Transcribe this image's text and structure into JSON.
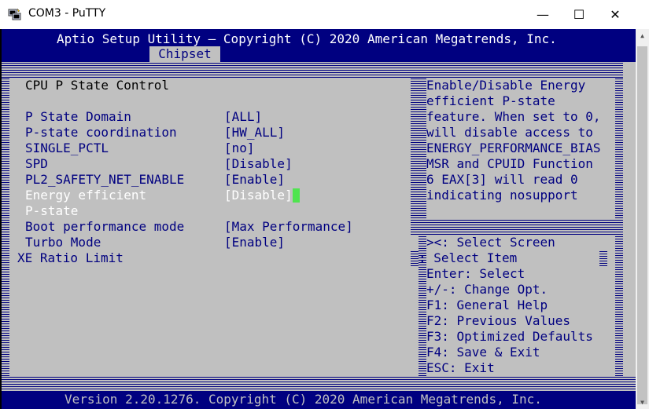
{
  "window": {
    "title": "COM3 - PuTTY",
    "minimize": "—",
    "maximize": "☐",
    "close": "✕"
  },
  "bios": {
    "header_title": "Aptio Setup Utility – Copyright (C) 2020 American Megatrends, Inc.",
    "active_tab": "Chipset",
    "section_title": "CPU P State Control",
    "settings": [
      {
        "label": "P State Domain",
        "value": "[ALL]"
      },
      {
        "label": "P-state coordination",
        "value": "[HW_ALL]"
      },
      {
        "label": "SINGLE_PCTL",
        "value": "[no]"
      },
      {
        "label": "SPD",
        "value": "[Disable]"
      },
      {
        "label": "PL2_SAFETY_NET_ENABLE",
        "value": "[Enable]"
      },
      {
        "label": "Energy efficient",
        "value": "[Disable]"
      },
      {
        "label": "P-state",
        "value": ""
      },
      {
        "label": "Boot performance mode",
        "value": "[Max Performance]"
      },
      {
        "label": "Turbo Mode",
        "value": "[Enable]"
      }
    ],
    "extra_item": "XE Ratio Limit",
    "help_lines": [
      "Enable/Disable Energy",
      "efficient P-state",
      "feature. When set to 0,",
      "will disable access to",
      "ENERGY_PERFORMANCE_BIAS",
      "MSR and CPUID Function",
      "6 EAX[3] will read 0",
      "indicating nosupport"
    ],
    "key_lines": [
      "><: Select Screen",
      ": Select Item",
      "Enter: Select",
      "+/-: Change Opt.",
      "F1: General Help",
      "F2: Previous Values",
      "F3: Optimized Defaults",
      "F4: Save & Exit",
      "ESC: Exit"
    ],
    "footer": "Version 2.20.1276. Copyright (C) 2020 American Megatrends, Inc."
  }
}
